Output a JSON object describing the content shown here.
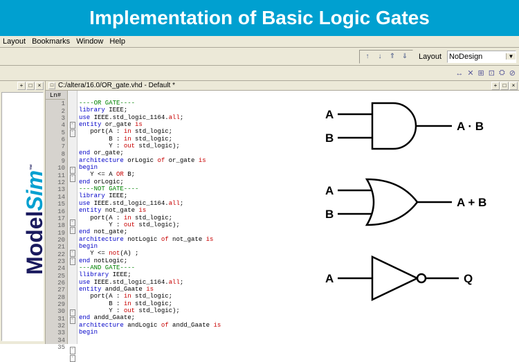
{
  "banner": {
    "title": "Implementation of Basic Logic Gates"
  },
  "menubar": {
    "items": [
      "Layout",
      "Bookmarks",
      "Window",
      "Help"
    ]
  },
  "toolbar": {
    "layout_label": "Layout",
    "layout_value": "NoDesign",
    "nav_icons": [
      "↑",
      "↓",
      "⇑",
      "⇓"
    ]
  },
  "left_pane": {
    "items": [
      " ",
      " ",
      " ",
      " "
    ]
  },
  "brand": {
    "part1": "Model",
    "part2": "Sim",
    "tm": "™"
  },
  "editor": {
    "title": "C:/altera/16.0/OR_gate.vhd - Default *",
    "gutter_header": "Ln#",
    "lines": [
      {
        "n": 1,
        "cls": "c-comment",
        "t": "----OR GATE----"
      },
      {
        "n": 2,
        "cls": "c-keyword",
        "t": "library ",
        "rest": "IEEE;"
      },
      {
        "n": 3,
        "cls": "c-keyword",
        "t": "use ",
        "rest": "IEEE.std_logic_1164.",
        "red": "all",
        "tail": ";"
      },
      {
        "n": 4,
        "cls": "c-keyword",
        "t": "entity ",
        "rest": "or_gate ",
        "red": "is",
        "fold": "minus"
      },
      {
        "n": 5,
        "cls": "",
        "t": "   port(A : ",
        "red": "in",
        "tail": " std_logic;",
        "fold": "minus"
      },
      {
        "n": 6,
        "cls": "",
        "t": "        B : ",
        "red": "in",
        "tail": " std_logic;"
      },
      {
        "n": 7,
        "cls": "",
        "t": "        Y : ",
        "red": "out",
        "tail": " std_logic);"
      },
      {
        "n": 8,
        "cls": "c-keyword",
        "t": "end ",
        "rest": "or_gate;"
      },
      {
        "n": 9,
        "cls": "",
        "t": ""
      },
      {
        "n": 10,
        "cls": "c-keyword",
        "t": "architecture ",
        "rest": "orLogic ",
        "red": "of",
        "tail": " or_gate ",
        "red2": "is",
        "fold": "minus"
      },
      {
        "n": 11,
        "cls": "c-keyword",
        "t": "begin",
        "fold": "minus"
      },
      {
        "n": 12,
        "cls": "",
        "t": "   Y <= A ",
        "red": "OR",
        "tail": " B;"
      },
      {
        "n": 13,
        "cls": "c-keyword",
        "t": "end ",
        "rest": "orLogic;"
      },
      {
        "n": 14,
        "cls": "c-comment",
        "t": "----NOT GATE----"
      },
      {
        "n": 15,
        "cls": "c-keyword",
        "t": "library ",
        "rest": "IEEE;"
      },
      {
        "n": 16,
        "cls": "c-keyword",
        "t": "use ",
        "rest": "IEEE.std_logic_1164.",
        "red": "all",
        "tail": ";"
      },
      {
        "n": 17,
        "cls": "c-keyword",
        "t": "entity ",
        "rest": "not_gate ",
        "red": "is",
        "fold": "minus"
      },
      {
        "n": 18,
        "cls": "",
        "t": "   port(A : ",
        "red": "in",
        "tail": " std_logic;",
        "fold": "minus"
      },
      {
        "n": 19,
        "cls": "",
        "t": "        Y : ",
        "red": "out",
        "tail": " std_logic);"
      },
      {
        "n": 20,
        "cls": "c-keyword",
        "t": "end ",
        "rest": "not_gate;"
      },
      {
        "n": 21,
        "cls": "c-keyword",
        "t": "architecture ",
        "rest": "notLogic ",
        "red": "of",
        "tail": " not_gate ",
        "red2": "is",
        "fold": "minus"
      },
      {
        "n": 22,
        "cls": "c-keyword",
        "t": "begin",
        "fold": "minus"
      },
      {
        "n": 23,
        "cls": "",
        "t": "   Y <= ",
        "red": "not",
        "tail": "(A) ;"
      },
      {
        "n": 24,
        "cls": "c-keyword",
        "t": "end ",
        "rest": "notLogic;"
      },
      {
        "n": 25,
        "cls": "",
        "t": ""
      },
      {
        "n": 26,
        "cls": "c-comment",
        "t": "---AND GATE----"
      },
      {
        "n": 27,
        "cls": "c-keyword",
        "t": "llibrary ",
        "rest": "IEEE;"
      },
      {
        "n": 28,
        "cls": "c-keyword",
        "t": "use ",
        "rest": "IEEE.std_logic_1164.",
        "red": "all",
        "tail": ";"
      },
      {
        "n": 29,
        "cls": "c-keyword",
        "t": "entity ",
        "rest": "andd_Gaate ",
        "red": "is",
        "fold": "minus"
      },
      {
        "n": 30,
        "cls": "",
        "t": "   port(A : ",
        "red": "in",
        "tail": " std_logic;",
        "fold": "minus"
      },
      {
        "n": 31,
        "cls": "",
        "t": "        B : ",
        "red": "in",
        "tail": " std_logic;"
      },
      {
        "n": 32,
        "cls": "",
        "t": "        Y : ",
        "red": "out",
        "tail": " std_logic);"
      },
      {
        "n": 33,
        "cls": "c-keyword",
        "t": "end ",
        "rest": "andd_Gaate;"
      },
      {
        "n": 34,
        "cls": "c-keyword",
        "t": "architecture ",
        "rest": "andLogic ",
        "red": "of",
        "tail": " andd_Gaate ",
        "red2": "is",
        "fold": "minus"
      },
      {
        "n": 35,
        "cls": "c-keyword",
        "t": "begin",
        "fold": "minus"
      }
    ]
  },
  "gates": {
    "and": {
      "in1": "A",
      "in2": "B",
      "out": "A · B"
    },
    "or": {
      "in1": "A",
      "in2": "B",
      "out": "A + B"
    },
    "not": {
      "in1": "A",
      "out": "Q"
    }
  },
  "toolbar2_icons": [
    "↔",
    "✕",
    "⊞",
    "⊡",
    "⛭",
    "⊘"
  ]
}
